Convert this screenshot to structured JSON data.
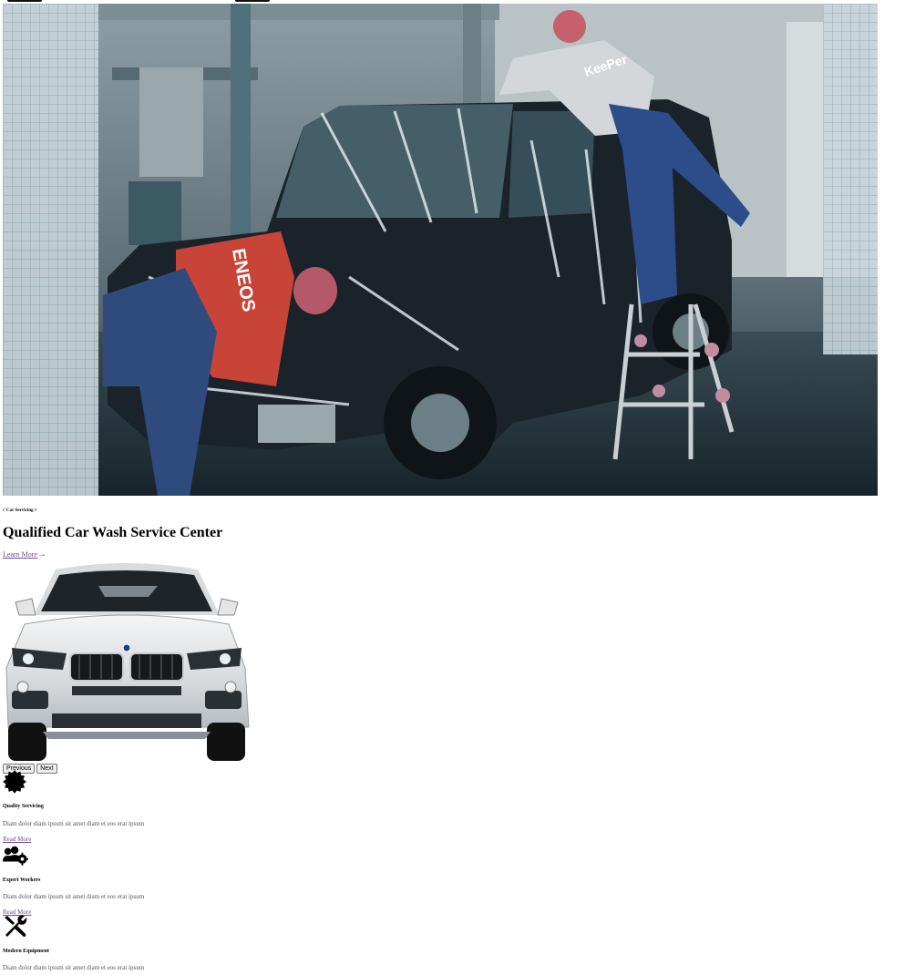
{
  "hero": {
    "image": "car-wash-photo",
    "uniform_text_front": "ENEOS",
    "uniform_text_back": "KeePer"
  },
  "carousel": {
    "eyebrow": "// Car Servicing //",
    "title": "Qualified Car Wash Service Center",
    "cta_label": "Learn More",
    "cta_icon": "arrow-right-icon",
    "car_image": "white-suv-front",
    "prev_label": "Previous",
    "next_label": "Next"
  },
  "services": [
    {
      "icon": "certificate-icon",
      "title": "Quality Servicing",
      "desc": "Diam dolor diam ipsum sit amet diam et eos erat ipsum",
      "link": "Read More"
    },
    {
      "icon": "users-cog-icon",
      "title": "Expert Workers",
      "desc": "Diam dolor diam ipsum sit amet diam et eos erat ipsum",
      "link": "Read More"
    },
    {
      "icon": "tools-icon",
      "title": "Modern Equipment",
      "desc": "Diam dolor diam ipsum sit amet diam et eos erat ipsum",
      "link": ""
    }
  ],
  "colors": {
    "link": "#6b4e8f",
    "text": "#000000",
    "muted": "#555555"
  }
}
